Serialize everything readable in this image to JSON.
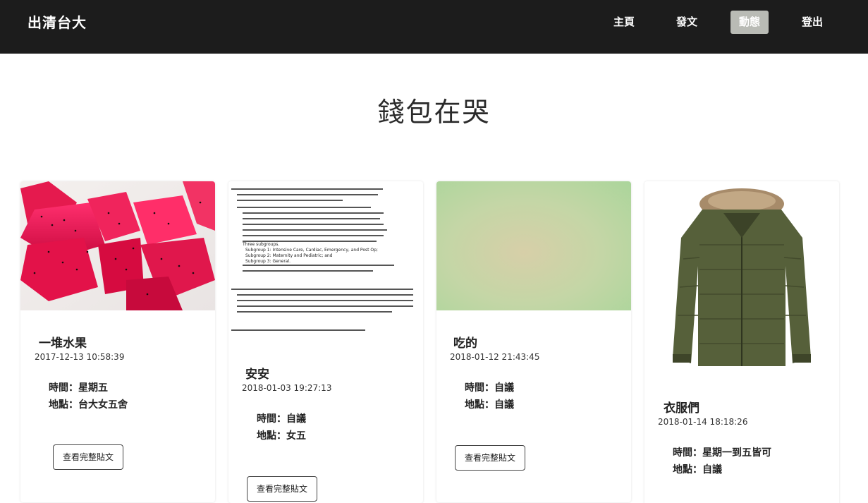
{
  "nav": {
    "brand": "出清台大",
    "items": [
      "主頁",
      "發文",
      "動態",
      "登出"
    ],
    "active": "動態",
    "active_color": "#b9bbb5",
    "bar_color": "#1c1c1c"
  },
  "page": {
    "title": "錢包在哭"
  },
  "cards": [
    {
      "title": "一堆水果",
      "date": "2017-12-13 10:58:39",
      "time_line": "時間：星期五",
      "place_line": "地點：台大女五舍",
      "button": "查看完整貼文",
      "image": "dragon-fruit-photo"
    },
    {
      "title": "安安",
      "date": "2018-01-03 19:27:13",
      "time_line": "時間：自議",
      "place_line": "地點：女五",
      "button": "查看完整貼文",
      "image": "document-scan"
    },
    {
      "title": "吃的",
      "date": "2018-01-12 21:43:45",
      "time_line": "時間：自議",
      "place_line": "地點：自議",
      "button": "查看完整貼文",
      "image": "green-gradient"
    },
    {
      "title": "衣服們",
      "date": "2018-01-14 18:18:26",
      "time_line": "時間：星期一到五皆可",
      "place_line": "地點：自議",
      "image": "green-jacket-photo"
    }
  ],
  "doc_scan": {
    "lines": [
      "Subgroup 1: Intensive Care, Cardiac, Emergency, and Post Op;",
      "Subgroup 2: Maternity and Pediatric; and",
      "Subgroup 3: General."
    ],
    "intro": "Three subgroups."
  }
}
